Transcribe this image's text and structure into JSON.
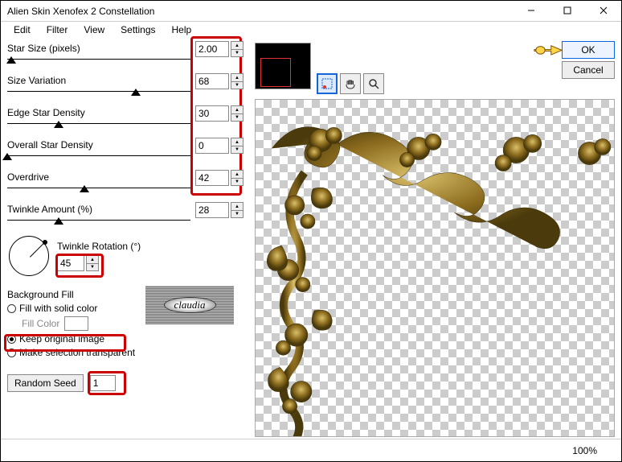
{
  "window": {
    "title": "Alien Skin Xenofex 2 Constellation"
  },
  "menu": {
    "edit": "Edit",
    "filter": "Filter",
    "view": "View",
    "settings": "Settings",
    "help": "Help"
  },
  "params": {
    "star_size": {
      "label": "Star Size (pixels)",
      "value": "2.00",
      "pos": 2
    },
    "size_variation": {
      "label": "Size Variation",
      "value": "68",
      "pos": 70
    },
    "edge_density": {
      "label": "Edge Star Density",
      "value": "30",
      "pos": 28
    },
    "overall_density": {
      "label": "Overall Star Density",
      "value": "0",
      "pos": 0
    },
    "overdrive": {
      "label": "Overdrive",
      "value": "42",
      "pos": 42
    },
    "twinkle_amount": {
      "label": "Twinkle Amount (%)",
      "value": "28",
      "pos": 28
    }
  },
  "twinkle_rotation": {
    "label": "Twinkle Rotation (°)",
    "value": "45"
  },
  "background_fill": {
    "heading": "Background Fill",
    "fill_solid": "Fill with solid color",
    "fill_color_label": "Fill Color",
    "keep_original": "Keep original image",
    "make_transparent": "Make selection transparent"
  },
  "random_seed": {
    "button": "Random Seed",
    "value": "1"
  },
  "watermark": {
    "text": "claudia"
  },
  "buttons": {
    "ok": "OK",
    "cancel": "Cancel"
  },
  "status": {
    "zoom": "100%"
  }
}
